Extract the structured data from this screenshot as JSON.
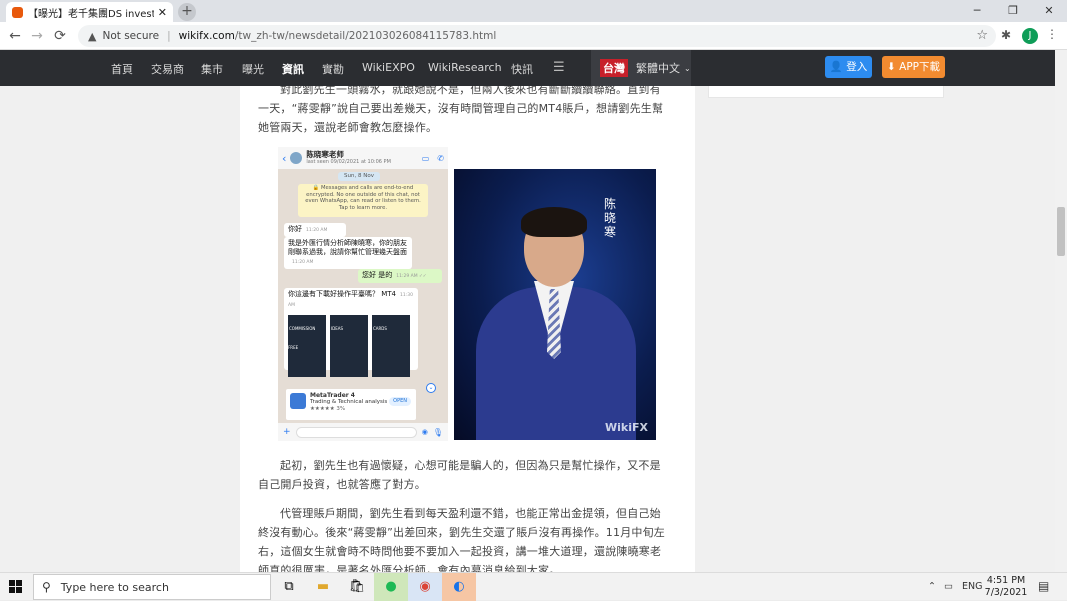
{
  "browser": {
    "tab_title": "【曝光】老千集團DS investment再",
    "tab_close": "✕",
    "new_tab": "+",
    "url_warning": "Not secure",
    "url_separator": "|",
    "url_host": "wikifx.com",
    "url_path": "/tw_zh-tw/newsdetail/202103026084115783.html",
    "profile_initial": "J"
  },
  "site_nav": {
    "items": [
      "首頁",
      "交易商",
      "集市",
      "曝光",
      "資訊",
      "實勘",
      "WikiEXPO",
      "WikiResearch",
      "快訊"
    ],
    "active_index": 4,
    "region": "台灣",
    "language": "繁體中文",
    "login_label": "登入",
    "app_label": "APP下載"
  },
  "article": {
    "para_top": "對此劉先生一頭霧水，就跟她說不是，但兩人後來也有斷斷續續聯絡。直到有一天，“蔣雯靜”說自己要出差幾天，沒有時間管理自己的MT4賬戶，想請劉先生幫她管兩天，還說老師會教怎麼操作。",
    "para_1": "起初，劉先生也有過懷疑，心想可能是騙人的，但因為只是幫忙操作，又不是自己開戶投資，也就答應了對方。",
    "para_2": "代管理賬戶期間，劉先生看到每天盈利還不錯，也能正常出金提領，但自己始終沒有動心。後來“蔣雯靜”出差回來，劉先生交還了賬戶沒有再操作。11月中旬左右，這個女生就會時不時問他要不要加入一起投資，講一堆大道理，還說陳曉寒老師真的很厲害，是著名外匯分析師，會有內幕消息給到大家。"
  },
  "chat": {
    "contact_name": "陈晓寒老师",
    "contact_sub": "last seen 09/02/2021 at 10:06 PM",
    "date_pill": "Sun, 8 Nov",
    "encryption": "🔒 Messages and calls are end-to-end encrypted. No one outside of this chat, not even WhatsApp, can read or listen to them. Tap to learn more.",
    "msg1": "你好",
    "msg1_time": "11:20 AM",
    "msg2": "我是外匯行情分析師陳曉寒，你的朋友剛聯系過我，說請你幫忙管理幾天盤面",
    "msg2_time": "11:20 AM",
    "msg3": "您好 是的",
    "msg3_time": "11:29 AM ✓✓",
    "msg4": "你這邊有下載好操作平臺嗎？ MT4",
    "msg4_time": "11:30 AM",
    "shots": [
      "COMMISSION FREE",
      "IDEAS",
      "CARDS"
    ],
    "app_name": "MetaTrader 4",
    "app_sub": "Trading & Technical analysis",
    "app_rating": "★★★★★ 3%",
    "app_open": "OPEN"
  },
  "photo": {
    "signature": "陈晓寒",
    "watermark": "WikiFX"
  },
  "taskbar": {
    "search_placeholder": "Type here to search",
    "lang": "ENG",
    "time": "4:51 PM",
    "date": "7/3/2021"
  }
}
